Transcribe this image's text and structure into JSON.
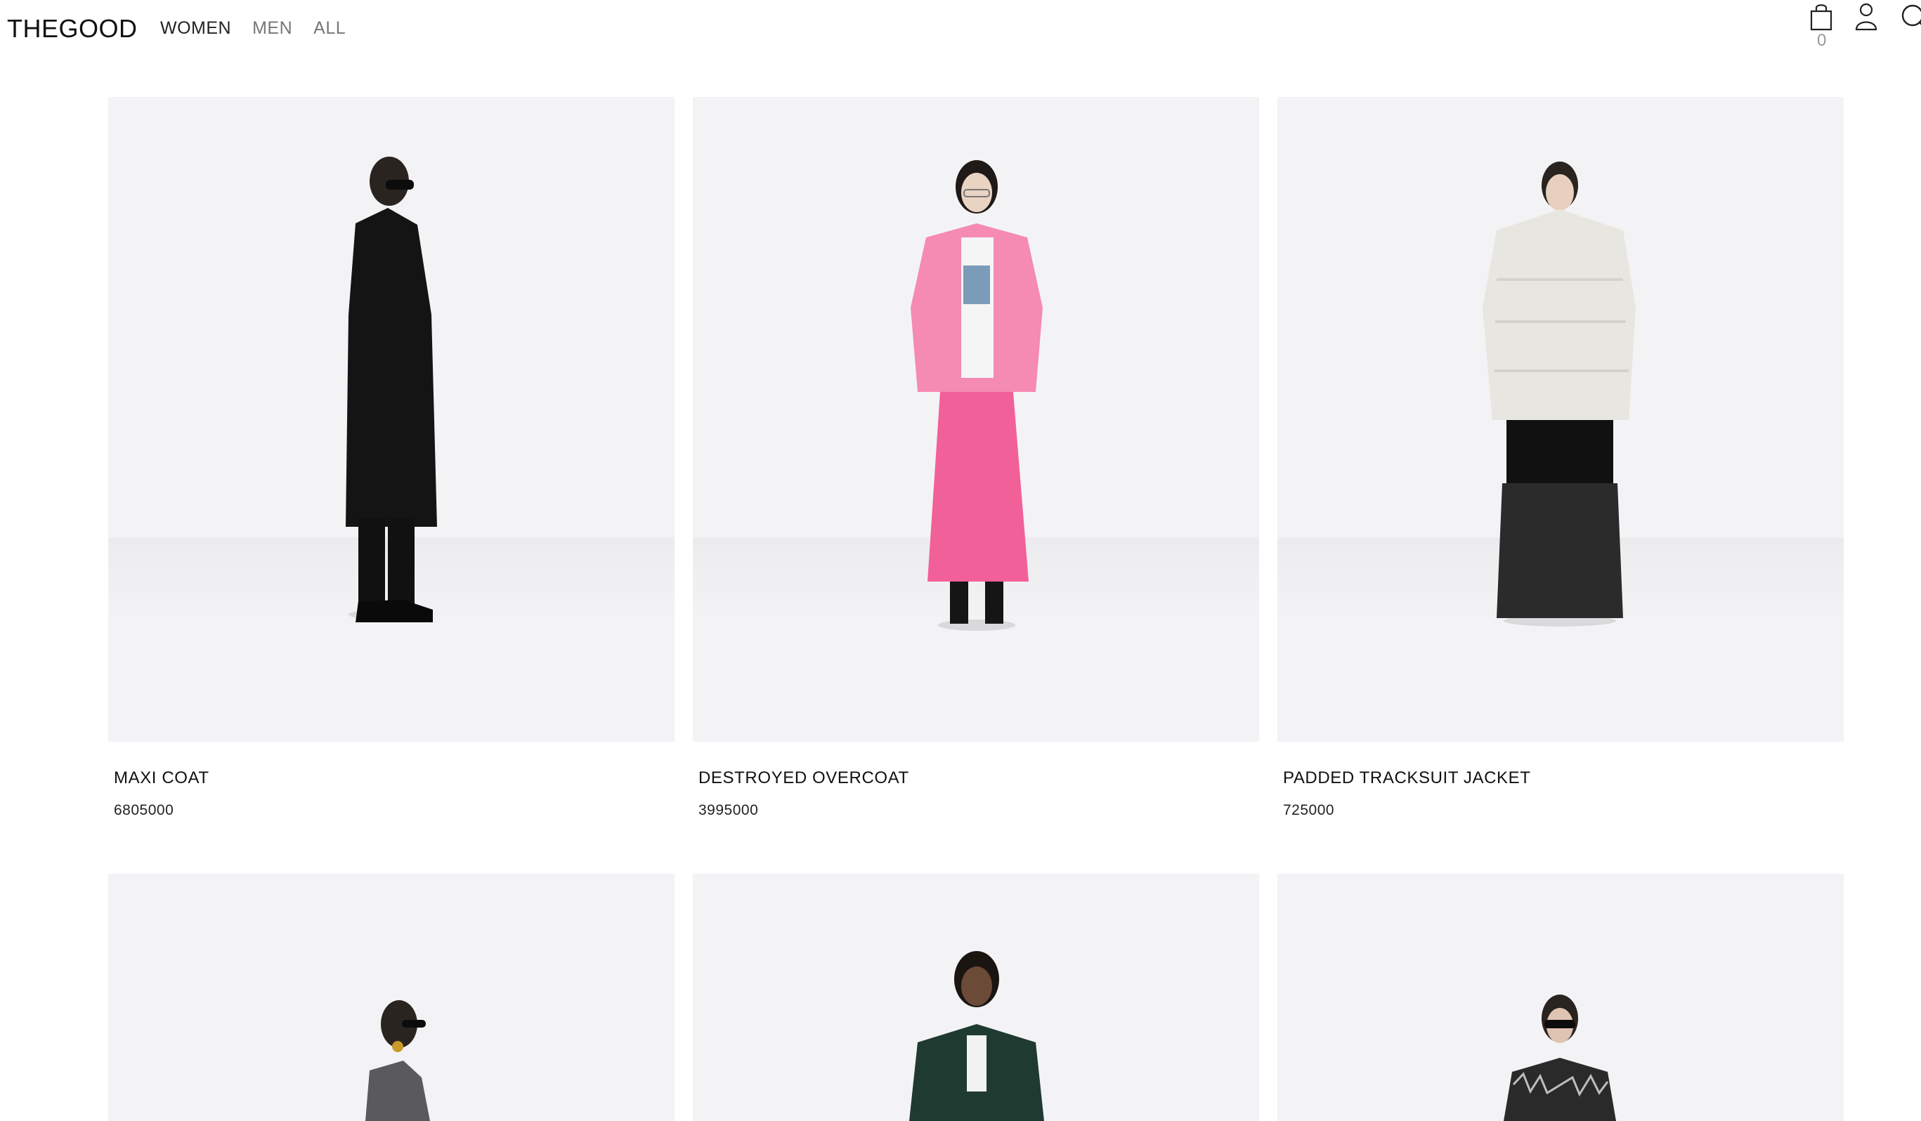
{
  "header": {
    "logo": "THEGOOD",
    "nav": [
      {
        "label": "WOMEN",
        "active": true
      },
      {
        "label": "MEN",
        "active": false
      },
      {
        "label": "ALL",
        "active": false
      }
    ],
    "cart_count": "0",
    "icons": [
      "shopping-bag-icon",
      "user-icon",
      "search-icon"
    ]
  },
  "products": [
    {
      "name": "MAXI COAT",
      "price": "6805000",
      "outfit": "black long coat",
      "colors": {
        "garment": "#151515",
        "lower": "#111111"
      }
    },
    {
      "name": "DESTROYED OVERCOAT",
      "price": "3995000",
      "outfit": "pink jacket and pleated skirt",
      "colors": {
        "garment": "#f58ab3",
        "lower": "#f2609a"
      }
    },
    {
      "name": "PADDED TRACKSUIT JACKET",
      "price": "725000",
      "outfit": "cream puffer jacket and wide black jeans",
      "colors": {
        "garment": "#e8e6e0",
        "lower": "#2b2b2b"
      }
    }
  ],
  "products_row2": [
    {
      "outfit": "grey leather jacket"
    },
    {
      "outfit": "dark green blazer"
    },
    {
      "outfit": "black feather jacket"
    }
  ]
}
